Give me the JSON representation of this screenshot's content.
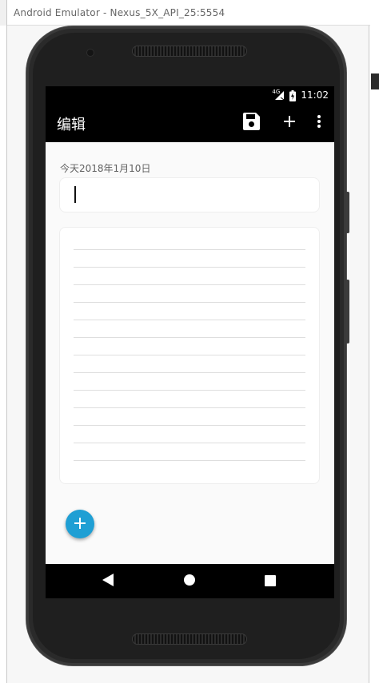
{
  "window": {
    "title": "Android Emulator - Nexus_5X_API_25:5554"
  },
  "statusbar": {
    "network": "4G",
    "time": "11:02"
  },
  "appbar": {
    "title": "编辑",
    "actions": [
      {
        "icon": "save-icon"
      },
      {
        "icon": "add-icon"
      },
      {
        "icon": "more-vert-icon"
      }
    ]
  },
  "editor": {
    "date_label": "今天2018年1月10日",
    "title_value": "",
    "body_value": "",
    "ruled_line_count": 13
  },
  "fab": {
    "icon": "add-icon",
    "color": "#1f9fd4"
  },
  "navbar": {
    "buttons": [
      {
        "icon": "back-icon"
      },
      {
        "icon": "home-icon"
      },
      {
        "icon": "recents-icon"
      }
    ]
  },
  "colors": {
    "appbar": "#000000",
    "content_background": "#fafafa",
    "accent": "#1f9fd4"
  }
}
